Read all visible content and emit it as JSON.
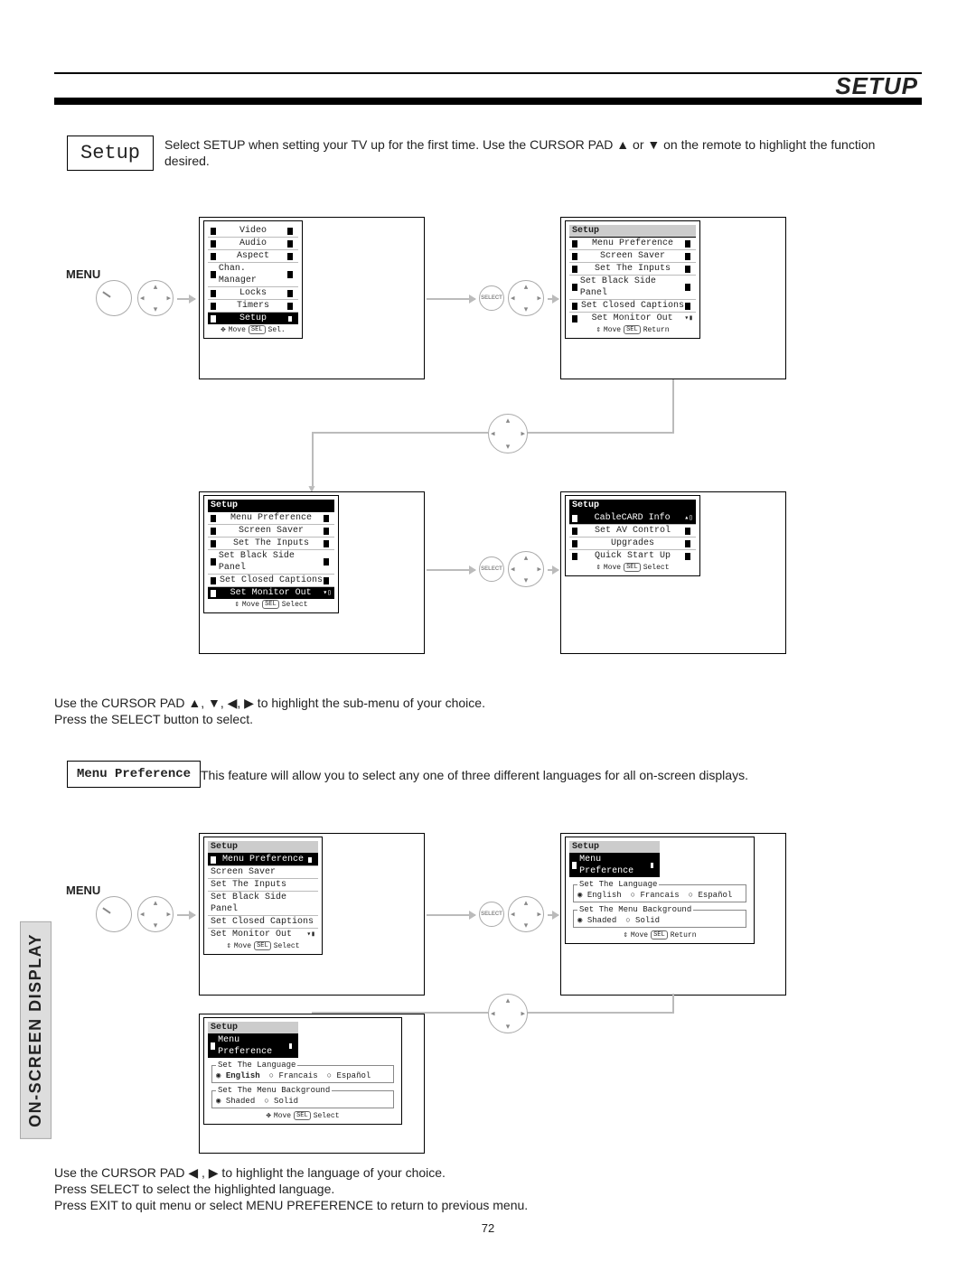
{
  "header": {
    "title": "SETUP"
  },
  "setup_box": {
    "label": "Setup"
  },
  "intro_text": "Select SETUP when setting your TV up for the first time.  Use the CURSOR PAD ▲ or ▼ on the remote to highlight the function desired.",
  "menu_label": "MENU",
  "figure1": {
    "main_menu": {
      "items": [
        "Video",
        "Audio",
        "Aspect",
        "Chan. Manager",
        "Locks",
        "Timers",
        "Setup"
      ],
      "selected": "Setup",
      "foot_move": "Move",
      "foot_sel": "Sel."
    },
    "select_label": "SELECT",
    "setup_menu_a": {
      "header": "Setup",
      "items": [
        "Menu Preference",
        "Screen Saver",
        "Set The Inputs",
        "Set Black Side Panel",
        "Set Closed Captions",
        "Set Monitor Out"
      ],
      "foot_move": "Move",
      "foot_ret": "Return"
    },
    "setup_menu_b": {
      "header": "Setup",
      "items": [
        "Menu Preference",
        "Screen Saver",
        "Set The Inputs",
        "Set Black Side Panel",
        "Set Closed Captions",
        "Set Monitor Out"
      ],
      "selected": "Set Monitor Out",
      "foot_move": "Move",
      "foot_sel": "Select"
    },
    "setup_menu_c": {
      "header": "Setup",
      "items": [
        "CableCARD Info",
        "Set AV Control",
        "Upgrades",
        "Quick Start Up"
      ],
      "selected": "CableCARD Info",
      "foot_move": "Move",
      "foot_sel": "Select"
    }
  },
  "mid_text_line1": "Use the CURSOR PAD ▲, ▼, ◀, ▶ to highlight the sub-menu of your choice.",
  "mid_text_line2": "Press the SELECT button to select.",
  "menupref_box": {
    "label": "Menu Preference"
  },
  "menupref_text": "This feature will allow you to select any one of three different languages for all on-screen displays.",
  "figure2": {
    "setup_menu_d": {
      "header": "Setup",
      "items": [
        "Menu Preference",
        "Screen Saver",
        "Set The Inputs",
        "Set Black Side Panel",
        "Set Closed Captions",
        "Set Monitor Out"
      ],
      "selected": "Menu Preference",
      "foot_move": "Move",
      "foot_sel": "Select"
    },
    "menupref_screen_a": {
      "header": "Setup",
      "sub": "Menu Preference",
      "lang_legend": "Set The Language",
      "lang_opts": [
        "English",
        "Francais",
        "Español"
      ],
      "bg_legend": "Set The Menu Background",
      "bg_opts": [
        "Shaded",
        "Solid"
      ],
      "foot_move": "Move",
      "foot_ret": "Return"
    },
    "menupref_screen_b": {
      "header": "Setup",
      "sub": "Menu Preference",
      "lang_legend": "Set The Language",
      "lang_opts": [
        "English",
        "Francais",
        "Español"
      ],
      "lang_sel": "English",
      "bg_legend": "Set The Menu Background",
      "bg_opts": [
        "Shaded",
        "Solid"
      ],
      "bg_sel": "Shaded",
      "foot_move": "Move",
      "foot_sel": "Select"
    }
  },
  "bottom_text_line1": "Use the CURSOR PAD ◀ , ▶ to highlight the language of your choice.",
  "bottom_text_line2": "Press SELECT to select the highlighted language.",
  "bottom_text_line3": "Press EXIT to quit menu or select MENU PREFERENCE to return to previous menu.",
  "side_tab": "ON-SCREEN DISPLAY",
  "page_number": "72",
  "sel_abbr": "SEL"
}
